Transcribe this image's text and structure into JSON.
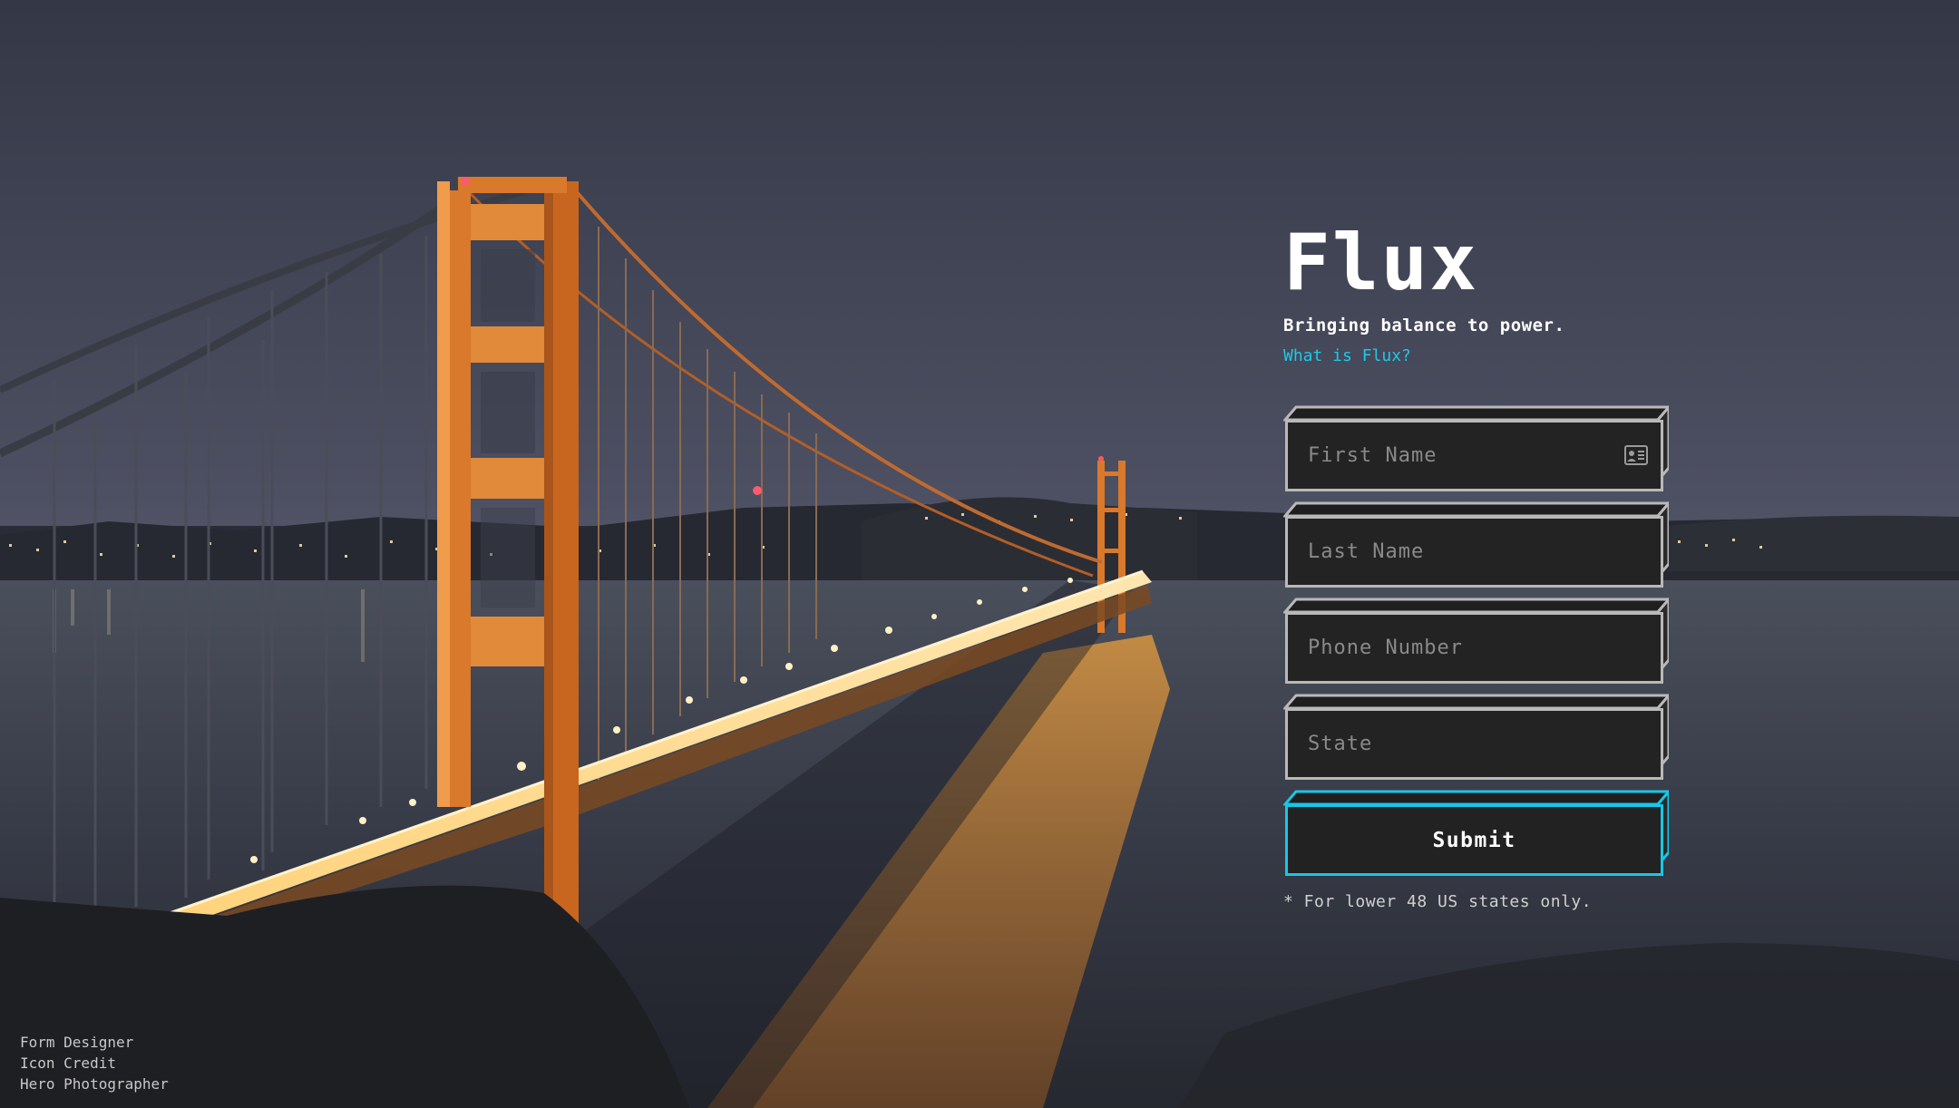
{
  "brand": {
    "title": "Flux",
    "tagline": "Bringing balance to power.",
    "info_link": "What is Flux?"
  },
  "form": {
    "first_name": {
      "placeholder": "First Name",
      "value": "",
      "icon": "contact-card-icon"
    },
    "last_name": {
      "placeholder": "Last Name",
      "value": ""
    },
    "phone": {
      "placeholder": "Phone Number",
      "value": ""
    },
    "state": {
      "placeholder": "State",
      "value": ""
    },
    "submit_label": "Submit",
    "footnote": "* For lower 48 US states only."
  },
  "credits": {
    "form_designer": "Form Designer",
    "icon_credit": "Icon Credit",
    "hero_photographer": "Hero Photographer"
  },
  "colors": {
    "accent": "#1ec9e8",
    "field_bg": "#232323",
    "field_border": "#b9b9b9",
    "bridge": "#d9792c"
  }
}
